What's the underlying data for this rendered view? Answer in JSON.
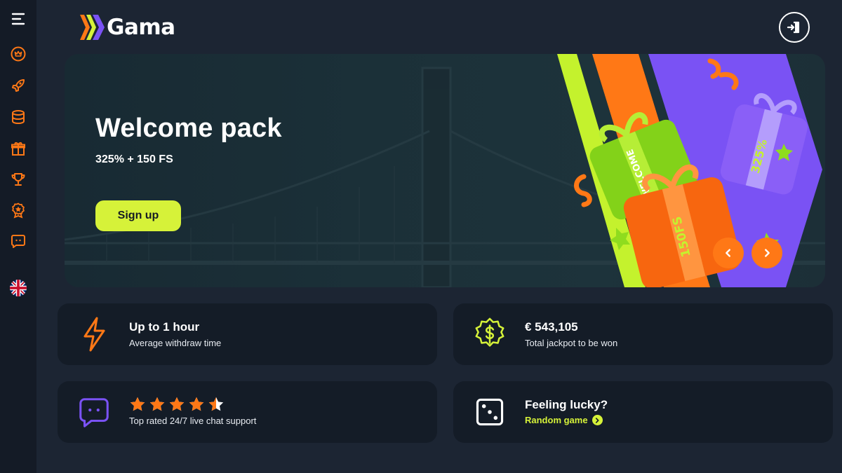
{
  "brand": {
    "name": "Gama"
  },
  "sidebar": {
    "items": [
      {
        "icon": "menu-icon"
      },
      {
        "icon": "crown-icon"
      },
      {
        "icon": "rocket-icon"
      },
      {
        "icon": "coins-icon"
      },
      {
        "icon": "gift-icon"
      },
      {
        "icon": "trophy-icon"
      },
      {
        "icon": "medal-icon"
      },
      {
        "icon": "chat-icon"
      },
      {
        "icon": "uk-flag-icon"
      }
    ]
  },
  "header": {
    "login_icon": "login-icon"
  },
  "hero": {
    "title": "Welcome pack",
    "subtitle": "325% + 150 FS",
    "cta_label": "Sign up",
    "gift_green_text": "WELCOME",
    "gift_purple_text": "325%",
    "gift_orange_text": "150FS"
  },
  "features": [
    {
      "title": "Up to 1 hour",
      "subtitle": "Average withdraw time",
      "icon": "lightning-icon"
    },
    {
      "title": "€  543,105",
      "subtitle": "Total jackpot to be won",
      "icon": "dollar-badge-icon"
    },
    {
      "rating": 4.5,
      "subtitle": "Top rated 24/7 live chat support",
      "icon": "chat-icon"
    },
    {
      "title": "Feeling lucky?",
      "link_label": "Random game",
      "icon": "dice-icon"
    }
  ],
  "colors": {
    "accent": "#ff7816",
    "lime": "#d6f239",
    "purple": "#7a52f4",
    "background": "#1c2533"
  }
}
